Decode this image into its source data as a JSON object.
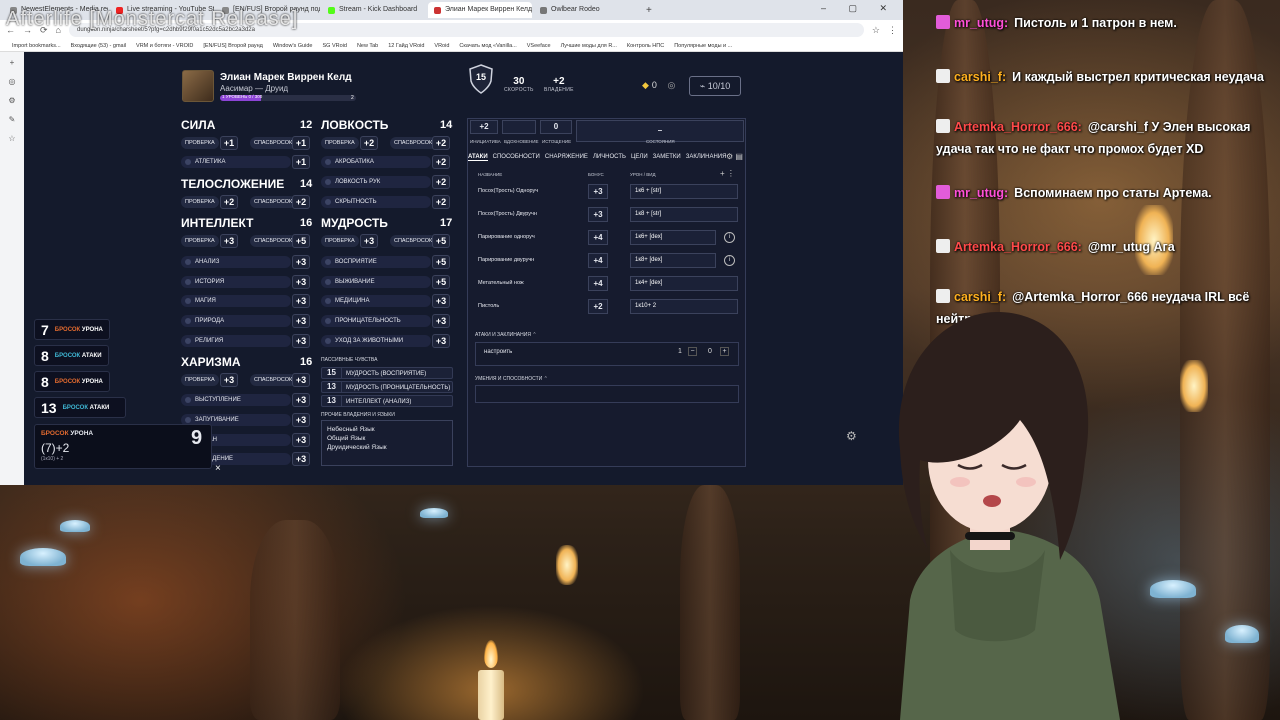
{
  "stream": {
    "title": "Afterlife [Monstercat Release]"
  },
  "browser": {
    "tabs": [
      "NewestElements - Media reque",
      "Live streaming - YouTube Studi",
      "[EN/FUS] Второй раунд подз",
      "Stream - Kick Dashboard",
      "Элиан Марек Виррен Келд | O",
      "Owlbear Rodeo"
    ],
    "address": "dungeon.ninja/charsheet/5?pfg=c2dhb9f29f0a1c52dc5a2bc2a3d2a",
    "bookmarks": [
      "Import bookmarks...",
      "Входящие (53) - gmail",
      "VRM и ботяги - VROID",
      "[EN/FUS] Второй раунд",
      "Window's Guide",
      "SG VRoid",
      "New Tab",
      "12 Гайд VRoid",
      "VRoid",
      "Скачать мод «Vanilla...",
      "VSeeface",
      "Лучшие моды для R...",
      "Контроль НПС",
      "Популярные моды и ..."
    ],
    "window_controls": "– ▢ ✕",
    "sidebar_icons": [
      "+",
      "◎",
      "⚙",
      "✎",
      "☆"
    ]
  },
  "character": {
    "name": "Элиан Марек Виррен Келд",
    "subtitle": "Аасимар — Друид",
    "level_label": "1 УРОВЕНЬ",
    "xp": "0 / 300",
    "next_level": "2",
    "level_progress": 0,
    "armor_class": "15",
    "speed": "30",
    "speed_label": "СКОРОСТЬ",
    "proficiency": "+2",
    "proficiency_label": "ВЛАДЕНИЕ",
    "coins": "0",
    "hp": "10/10"
  },
  "abilities": {
    "check_label": "ПРОВЕРКА",
    "save_label": "СПАСБРОСОК",
    "str": {
      "name": "СИЛА",
      "score": "12",
      "check": "+1",
      "save": "+1",
      "skills": [
        {
          "name": "АТЛЕТИКА",
          "value": "+1"
        }
      ]
    },
    "dex": {
      "name": "ЛОВКОСТЬ",
      "score": "14",
      "check": "+2",
      "save": "+2",
      "skills": [
        {
          "name": "АКРОБАТИКА",
          "value": "+2"
        },
        {
          "name": "ЛОВКОСТЬ РУК",
          "value": "+2"
        },
        {
          "name": "СКРЫТНОСТЬ",
          "value": "+2"
        }
      ]
    },
    "con": {
      "name": "ТЕЛОСЛОЖЕНИЕ",
      "score": "14",
      "check": "+2",
      "save": "+2"
    },
    "int": {
      "name": "ИНТЕЛЛЕКТ",
      "score": "16",
      "check": "+3",
      "save": "+5",
      "skills": [
        {
          "name": "АНАЛИЗ",
          "value": "+3"
        },
        {
          "name": "ИСТОРИЯ",
          "value": "+3"
        },
        {
          "name": "МАГИЯ",
          "value": "+3"
        },
        {
          "name": "ПРИРОДА",
          "value": "+3"
        },
        {
          "name": "РЕЛИГИЯ",
          "value": "+3"
        }
      ]
    },
    "wis": {
      "name": "МУДРОСТЬ",
      "score": "17",
      "check": "+3",
      "save": "+5",
      "skills": [
        {
          "name": "ВОСПРИЯТИЕ",
          "value": "+5"
        },
        {
          "name": "ВЫЖИВАНИЕ",
          "value": "+5"
        },
        {
          "name": "МЕДИЦИНА",
          "value": "+3"
        },
        {
          "name": "ПРОНИЦАТЕЛЬНОСТЬ",
          "value": "+3"
        },
        {
          "name": "УХОД ЗА ЖИВОТНЫМИ",
          "value": "+3"
        }
      ]
    },
    "cha": {
      "name": "ХАРИЗМА",
      "score": "16",
      "check": "+3",
      "save": "+3",
      "skills": [
        {
          "name": "ВЫСТУПЛЕНИЕ",
          "value": "+3"
        },
        {
          "name": "ЗАПУГИВАНИЕ",
          "value": "+3"
        },
        {
          "name": "ОБМАН",
          "value": "+3"
        },
        {
          "name": "УБЕЖДЕНИЕ",
          "value": "+3"
        }
      ]
    }
  },
  "passives": {
    "title": "ПАССИВНЫЕ ЧУВСТВА",
    "items": [
      {
        "value": "15",
        "name": "МУДРОСТЬ (ВОСПРИЯТИЕ)"
      },
      {
        "value": "13",
        "name": "МУДРОСТЬ (ПРОНИЦАТЕЛЬНОСТЬ)"
      },
      {
        "value": "13",
        "name": "ИНТЕЛЛЕКТ (АНАЛИЗ)"
      }
    ],
    "languages_title": "ПРОЧИЕ ВЛАДЕНИЯ И ЯЗЫКИ",
    "languages": [
      "Небесный Язык",
      "Общий Язык",
      "Друидический Язык"
    ]
  },
  "combat": {
    "initiative": "+2",
    "initiative_label": "ИНИЦИАТИВА",
    "advantage_label": "ВДОХНОВЕНИЕ",
    "exhaustion": "0",
    "exhaustion_label": "ИСТОЩЕНИЕ",
    "conditions_value": "–",
    "conditions_label": "СОСТОЯНИЯ"
  },
  "tabs": [
    "АТАКИ",
    "СПОСОБНОСТИ",
    "СНАРЯЖЕНИЕ",
    "ЛИЧНОСТЬ",
    "ЦЕЛИ",
    "ЗАМЕТКИ",
    "ЗАКЛИНАНИЯ"
  ],
  "attacks": {
    "headers": {
      "name": "НАЗВАНИЕ",
      "bonus": "БОНУС",
      "damage": "УРОН / ВИД"
    },
    "rows": [
      {
        "name": "Посох(Трость) Одноруч",
        "bonus": "+3",
        "damage": "1к6 + [str]"
      },
      {
        "name": "Посох(Трость) Двуручн",
        "bonus": "+3",
        "damage": "1к8 + [str]"
      },
      {
        "name": "Парирование одноруч",
        "bonus": "+4",
        "damage": "1к6+ [dex]"
      },
      {
        "name": "Парирование двуручн",
        "bonus": "+4",
        "damage": "1к8+ [dex]"
      },
      {
        "name": "Метательный нож",
        "bonus": "+4",
        "damage": "1к4+ [dex]"
      },
      {
        "name": "Пистоль",
        "bonus": "+2",
        "damage": "1к10+ 2"
      }
    ],
    "spells_section": "АТАКИ И ЗАКЛИНАНИЯ",
    "spells_input": "настроить",
    "spells_count": "1",
    "spells_value": "0",
    "abilities_section": "УМЕНИЯ И СПОСОБНОСТИ"
  },
  "dice_log": [
    {
      "value": "7",
      "label": "БРОСОК",
      "type": "УРОНА"
    },
    {
      "value": "8",
      "label": "БРОСОК",
      "type": "АТАКИ"
    },
    {
      "value": "8",
      "label": "БРОСОК",
      "type": "УРОНА"
    },
    {
      "value": "13",
      "label": "БРОСОК",
      "type": "АТАКИ"
    }
  ],
  "last_roll": {
    "label": "БРОСОК",
    "type": "УРОНА",
    "formula": "(7)+2",
    "detail": "(1к10) + 2",
    "total": "9",
    "close": "×"
  },
  "chat": [
    {
      "user": "mr_utug:",
      "text": "Пистоль и 1 патрон в нем.",
      "user_color": "#ff4fd8"
    },
    {
      "user": "carshi_f:",
      "text": "И каждый выстрел критическая неудача",
      "user_color": "#ffb01f"
    },
    {
      "user": "Artemka_Horror_666:",
      "text": "@carshi_f У Элен высокая удача так что не факт что промох будет XD",
      "user_color": "#ff4a4a"
    },
    {
      "user": "mr_utug:",
      "text": "Вспоминаем про статы Артема.",
      "user_color": "#ff4fd8"
    },
    {
      "user": "Artemka_Horror_666:",
      "text": "@mr_utug Ага",
      "user_color": "#ff4a4a"
    },
    {
      "user": "carshi_f:",
      "text": "@Artemka_Horror_666 неудача IRL всё нейтрализует",
      "user_color": "#ffb01f"
    }
  ]
}
